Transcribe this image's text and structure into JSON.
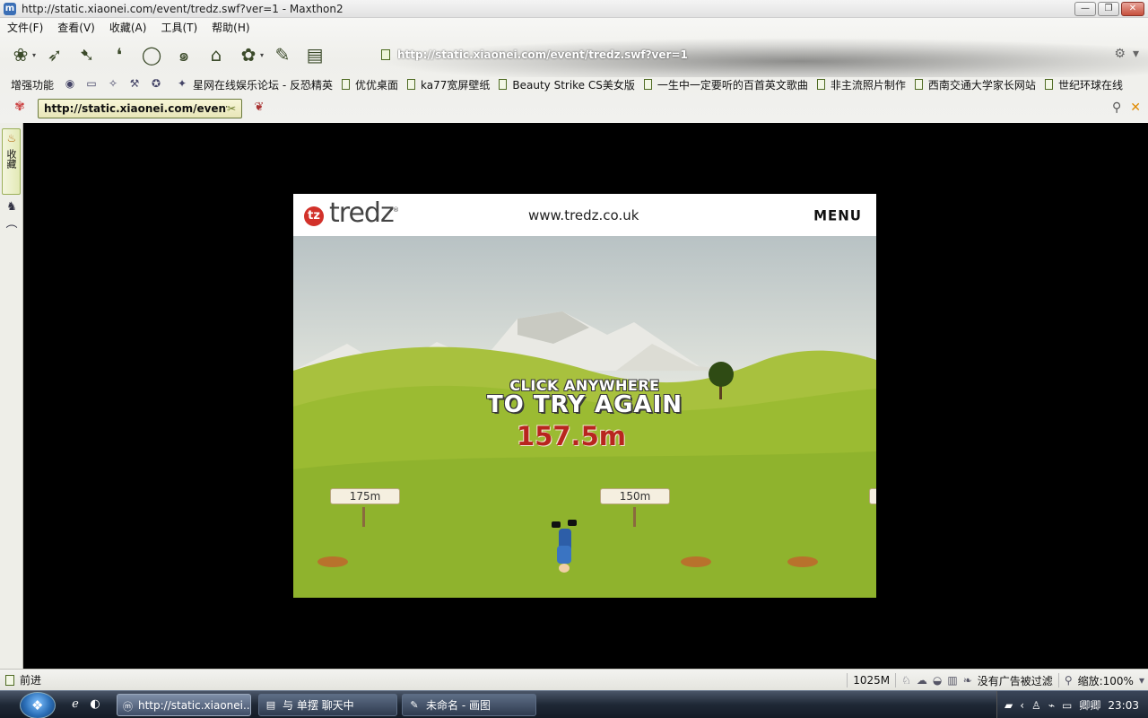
{
  "window": {
    "title": "http://static.xiaonei.com/event/tredz.swf?ver=1 - Maxthon2",
    "app_icon": "m",
    "buttons": {
      "minimize": "—",
      "maximize": "❐",
      "close": "✕"
    }
  },
  "menu": [
    {
      "label": "文件(F)"
    },
    {
      "label": "查看(V)"
    },
    {
      "label": "收藏(A)"
    },
    {
      "label": "工具(T)"
    },
    {
      "label": "帮助(H)"
    }
  ],
  "toolbar": {
    "icons": [
      "lotus-back-icon",
      "bird-forward-icon",
      "bird-refresh-icon",
      "brush-stop-icon",
      "ink-circle-home-icon",
      "snail-icon",
      "pavilion-icon",
      "frog-icon",
      "brush-icon",
      "book-icon"
    ],
    "address_value": "http://static.xiaonei.com/event/tredz.swf?ver=1"
  },
  "favorites": {
    "lead_label": "增强功能",
    "items": [
      {
        "label": "星网在线娱乐论坛 - 反恐精英"
      },
      {
        "label": "优优桌面"
      },
      {
        "label": "ka77宽屏壁纸"
      },
      {
        "label": "Beauty Strike CS美女版"
      },
      {
        "label": "一生中一定要听的百首英文歌曲"
      },
      {
        "label": "非主流照片制作"
      },
      {
        "label": "西南交通大学家长网站"
      },
      {
        "label": "世纪环球在线"
      }
    ]
  },
  "tabs": [
    {
      "label": "http://static.xiaonei.com/event...",
      "active": true
    }
  ],
  "sidepanel": {
    "favorites_label": "收藏"
  },
  "game": {
    "logo_text": "tredz",
    "logo_mark": "tz",
    "logo_reg": "®",
    "site_url": "www.tredz.co.uk",
    "menu_label": "MENU",
    "overlay_line1": "CLICK ANYWHERE",
    "overlay_line2": "TO TRY AGAIN",
    "distance": "157.5m",
    "signs": [
      {
        "label": "175m"
      },
      {
        "label": "150m"
      }
    ]
  },
  "statusbar": {
    "left_text": "前进",
    "memory": "1025M",
    "ad_filter": "没有广告被过滤",
    "zoom": "缩放:100%"
  },
  "taskbar": {
    "tasks": [
      {
        "label": "http://static.xiaonei....",
        "active": true
      },
      {
        "label": "与 单摆 聊天中",
        "active": false
      },
      {
        "label": "未命名 - 画图",
        "active": false
      }
    ],
    "clock": "23:03",
    "tray_label": "卿卿"
  },
  "colors": {
    "accent_red": "#d2312a",
    "distance_red": "#b8251e",
    "grass_green": "#8fb32d"
  }
}
